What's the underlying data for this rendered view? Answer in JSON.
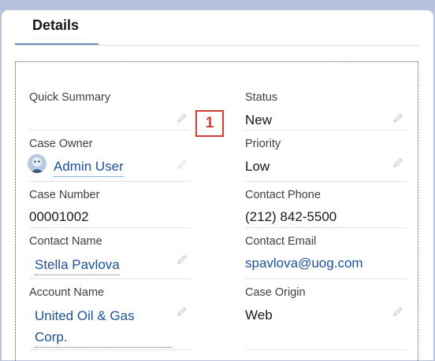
{
  "tabs": [
    {
      "label": "Details"
    }
  ],
  "badge": "1",
  "left_fields": [
    {
      "label": "Quick Summary",
      "value": ""
    },
    {
      "label": "Case Owner",
      "value": "Admin User"
    },
    {
      "label": "Case Number",
      "value": "00001002"
    },
    {
      "label": "Contact Name",
      "value": "Stella Pavlova"
    },
    {
      "label": "Account Name",
      "value_line1": "United Oil & Gas",
      "value_line2": "Corp."
    }
  ],
  "right_fields": [
    {
      "label": "Status",
      "value": "New"
    },
    {
      "label": "Priority",
      "value": "Low"
    },
    {
      "label": "Contact Phone",
      "value": "(212) 842-5500"
    },
    {
      "label": "Contact Email",
      "value": "spavlova@uog.com"
    },
    {
      "label": "Case Origin",
      "value": "Web"
    }
  ],
  "colors": {
    "link": "#1b5297",
    "badge": "#d13d2f",
    "tab_underline": "#6b8fc0"
  }
}
